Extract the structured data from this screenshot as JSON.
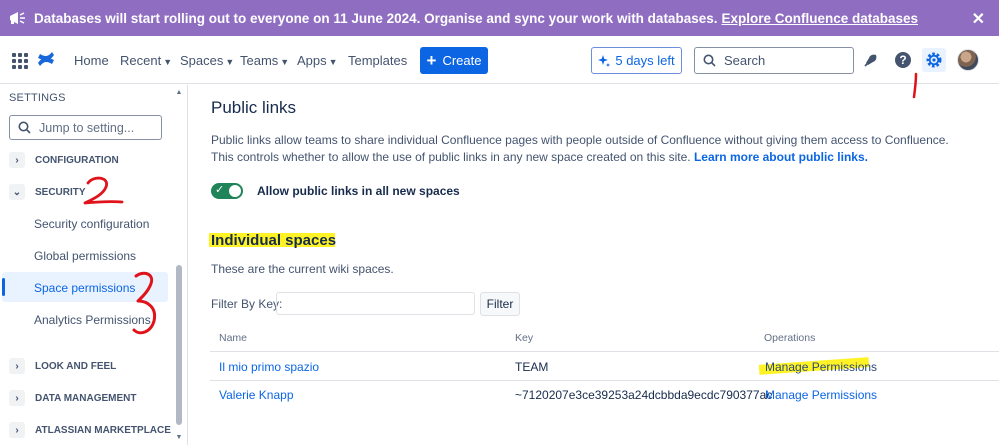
{
  "banner": {
    "text": "Databases will start rolling out to everyone on 11 June 2024. Organise and sync your work with databases.",
    "link": "Explore Confluence databases",
    "close": "✕"
  },
  "topnav": {
    "items": [
      "Home",
      "Recent",
      "Spaces",
      "Teams",
      "Apps",
      "Templates"
    ],
    "create_label": "Create",
    "trial_label": "5 days left",
    "search_placeholder": "Search"
  },
  "sidebar": {
    "title": "SETTINGS",
    "search_placeholder": "Jump to setting...",
    "sections": [
      "CONFIGURATION",
      "SECURITY",
      "LOOK AND FEEL",
      "DATA MANAGEMENT",
      "ATLASSIAN MARKETPLACE"
    ],
    "security_links": [
      "Security configuration",
      "Global permissions",
      "Space permissions",
      "Analytics Permissions"
    ]
  },
  "main": {
    "title": "Public links",
    "description": "Public links allow teams to share individual Confluence pages with people outside of Confluence without giving them access to Confluence. This controls whether to allow the use of public links in any new space created on this site.",
    "description_link": "Learn more about public links.",
    "toggle_label": "Allow public links in all new spaces",
    "spaces_title": "Individual spaces",
    "spaces_desc": "These are the current wiki spaces.",
    "filter_label": "Filter By Key:",
    "filter_button": "Filter",
    "table": {
      "headers": [
        "Name",
        "Key",
        "Operations"
      ],
      "rows": [
        {
          "name": "Il mio primo spazio",
          "key": "TEAM",
          "op": "Manage Permissions"
        },
        {
          "name": "Valerie Knapp",
          "key": "~7120207e3ce39253a24dcbbda9ecdc790377ac",
          "op": "Manage Permissions"
        }
      ]
    }
  },
  "annotations": [
    "1",
    "2",
    "3"
  ],
  "colors": {
    "banner": "#8f6ec2",
    "primary": "#0c66e4",
    "toggle_on": "#1f845a",
    "annotation_red": "#e0121a",
    "highlight": "#fff100"
  }
}
